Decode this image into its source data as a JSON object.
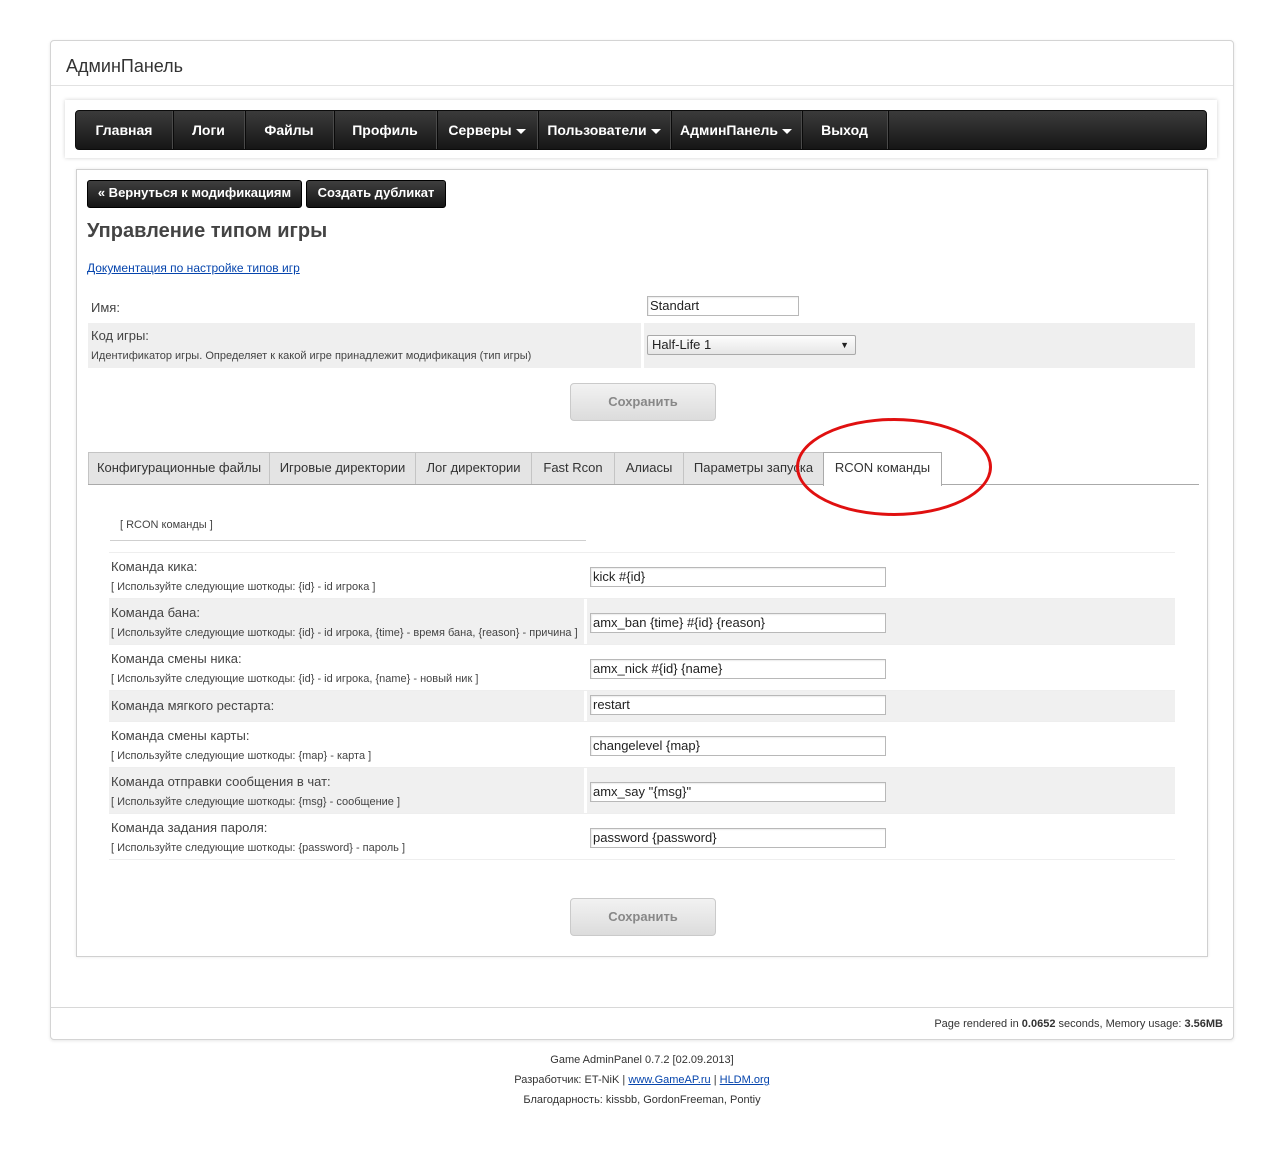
{
  "site": {
    "title": "АдминПанель"
  },
  "nav": {
    "items": [
      {
        "label": "Главная",
        "dropdown": false
      },
      {
        "label": "Логи",
        "dropdown": false
      },
      {
        "label": "Файлы",
        "dropdown": false
      },
      {
        "label": "Профиль",
        "dropdown": false
      },
      {
        "label": "Серверы",
        "dropdown": true
      },
      {
        "label": "Пользователи",
        "dropdown": true
      },
      {
        "label": "АдминПанель",
        "dropdown": true
      },
      {
        "label": "Выход",
        "dropdown": false
      }
    ]
  },
  "actions": {
    "back": "« Вернуться к модификациям",
    "duplicate": "Создать дубликат"
  },
  "page": {
    "heading": "Управление типом игры",
    "doc_link": "Документация по настройке типов игр"
  },
  "form": {
    "name_label": "Имя:",
    "name_value": "Standart",
    "code_label": "Код игры:",
    "code_hint": "Идентификатор игры. Определяет к какой игре принадлежит модификация (тип игры)",
    "code_value": "Half-Life 1",
    "save": "Сохранить"
  },
  "tabs": [
    {
      "label": "Конфигурационные файлы",
      "active": false
    },
    {
      "label": "Игровые директории",
      "active": false
    },
    {
      "label": "Лог директории",
      "active": false
    },
    {
      "label": "Fast Rcon",
      "active": false
    },
    {
      "label": "Алиасы",
      "active": false
    },
    {
      "label": "Параметры запуска",
      "active": false
    },
    {
      "label": "RCON команды",
      "active": true
    }
  ],
  "rcon": {
    "section_title": "[ RCON команды ]",
    "rows": [
      {
        "label": "Команда кика:",
        "hint": "[ Используйте следующие шоткоды: {id} - id игрока ]",
        "value": "kick #{id}"
      },
      {
        "label": "Команда бана:",
        "hint": "[ Используйте следующие шоткоды: {id} - id игрока, {time} - время бана, {reason} - причина ]",
        "value": "amx_ban {time} #{id} {reason}"
      },
      {
        "label": "Команда смены ника:",
        "hint": "[ Используйте следующие шоткоды: {id} - id игрока, {name} - новый ник ]",
        "value": "amx_nick #{id} {name}"
      },
      {
        "label": "Команда мягкого рестарта:",
        "hint": "",
        "value": "restart"
      },
      {
        "label": "Команда смены карты:",
        "hint": "[ Используйте следующие шоткоды: {map} - карта ]",
        "value": "changelevel {map}"
      },
      {
        "label": "Команда отправки сообщения в чат:",
        "hint": "[ Используйте следующие шоткоды: {msg} - сообщение ]",
        "value": "amx_say \"{msg}\""
      },
      {
        "label": "Команда задания пароля:",
        "hint": "[ Используйте следующие шоткоды: {password} - пароль ]",
        "value": "password {password}"
      }
    ],
    "save": "Сохранить"
  },
  "footer": {
    "render_prefix": "Page rendered in ",
    "render_time": "0.0652",
    "render_mid": " seconds, Memory usage: ",
    "memory": "3.56MB",
    "version": "Game AdminPanel 0.7.2 [02.09.2013]",
    "dev_prefix": "Разработчик: ET-NiK | ",
    "link1": "www.GameAP.ru",
    "sep": " | ",
    "link2": "HLDM.org",
    "thanks": "Благодарность: kissbb, GordonFreeman, Pontiy"
  },
  "colors": {
    "annotation_circle": "#e01010",
    "link": "#0645ad",
    "navbar": "#222222"
  }
}
